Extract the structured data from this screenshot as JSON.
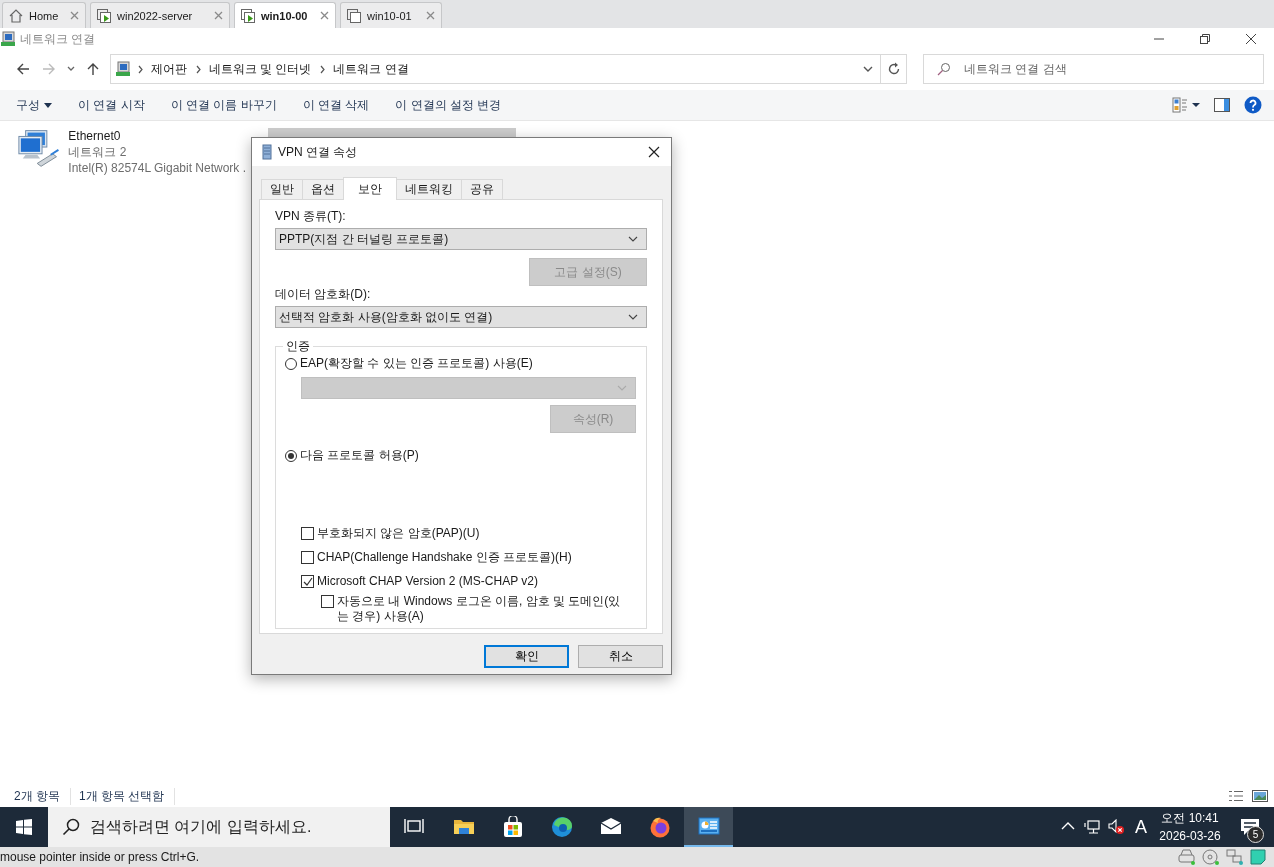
{
  "vm_tabs": [
    {
      "label": "Home",
      "kind": "home",
      "selected": false
    },
    {
      "label": "win2022-server",
      "kind": "vm-running",
      "selected": false
    },
    {
      "label": "win10-00",
      "kind": "vm-running",
      "selected": true
    },
    {
      "label": "win10-01",
      "kind": "vm-off",
      "selected": false
    }
  ],
  "window": {
    "title": "네트워크 연결"
  },
  "address": {
    "breadcrumbs": [
      "제어판",
      "네트워크 및 인터넷",
      "네트워크 연결"
    ]
  },
  "search": {
    "placeholder": "네트워크 연결 검색"
  },
  "commands": [
    {
      "label": "구성",
      "dropdown": true
    },
    {
      "label": "이 연결 시작",
      "dropdown": false
    },
    {
      "label": "이 연결 이름 바꾸기",
      "dropdown": false
    },
    {
      "label": "이 연결 삭제",
      "dropdown": false
    },
    {
      "label": "이 연결의 설정 변경",
      "dropdown": false
    }
  ],
  "connections": [
    {
      "name": "Ethernet0",
      "network": "네트워크 2",
      "adapter": "Intel(R) 82574L Gigabit Network .",
      "selected": false
    },
    {
      "selected": true
    }
  ],
  "dialog": {
    "title": "VPN 연결 속성",
    "tabs": [
      {
        "label": "일반",
        "selected": false
      },
      {
        "label": "옵션",
        "selected": false
      },
      {
        "label": "보안",
        "selected": true
      },
      {
        "label": "네트워킹",
        "selected": false
      },
      {
        "label": "공유",
        "selected": false
      }
    ],
    "vpn_type_label": "VPN 종류(T):",
    "vpn_type": "PPTP(지점 간 터널링 프로토콜)",
    "advanced_button": {
      "label": "고급 설정(S)",
      "disabled": true
    },
    "encryption_label": "데이터 암호화(D):",
    "encryption": "선택적 암호화 사용(암호화 없이도 연결)",
    "auth": {
      "legend": "인증",
      "eap_option": {
        "label": "EAP(확장할 수 있는 인증 프로토콜) 사용(E)",
        "selected": false
      },
      "eap_dropdown": {
        "disabled": true
      },
      "properties_button": {
        "label": "속성(R)",
        "disabled": true
      },
      "protocol_option": {
        "label": "다음 프로토콜 허용(P)",
        "selected": true
      },
      "protocols": [
        {
          "label": "부호화되지 않은 암호(PAP)(U)",
          "checked": false
        },
        {
          "label": "CHAP(Challenge Handshake 인증 프로토콜)(H)",
          "checked": false
        },
        {
          "label": "Microsoft CHAP Version 2 (MS-CHAP v2)",
          "checked": true,
          "children": [
            {
              "label": "자동으로 내 Windows 로그온 이름, 암호 및 도메인(있는 경우) 사용(A)",
              "checked": false
            }
          ]
        }
      ]
    },
    "buttons": [
      {
        "label": "확인",
        "default": true
      },
      {
        "label": "취소",
        "default": false
      }
    ]
  },
  "status_bar": {
    "items": [
      "2개 항목",
      "1개 항목 선택함"
    ]
  },
  "taskbar": {
    "search_placeholder": "검색하려면 여기에 입력하세요.",
    "apps": [
      {
        "kind": "task-view",
        "active": false
      },
      {
        "kind": "folder",
        "active": false
      },
      {
        "kind": "store",
        "active": false
      },
      {
        "kind": "browser",
        "active": false
      },
      {
        "kind": "mail",
        "active": false
      },
      {
        "kind": "firefox",
        "active": false
      },
      {
        "kind": "control-panel",
        "active": true
      }
    ],
    "ime": "A",
    "time": "오전 10:41",
    "date": "2026-03-26",
    "notifications": "5"
  },
  "vm_status": {
    "text": "mouse pointer inside or press Ctrl+G."
  }
}
